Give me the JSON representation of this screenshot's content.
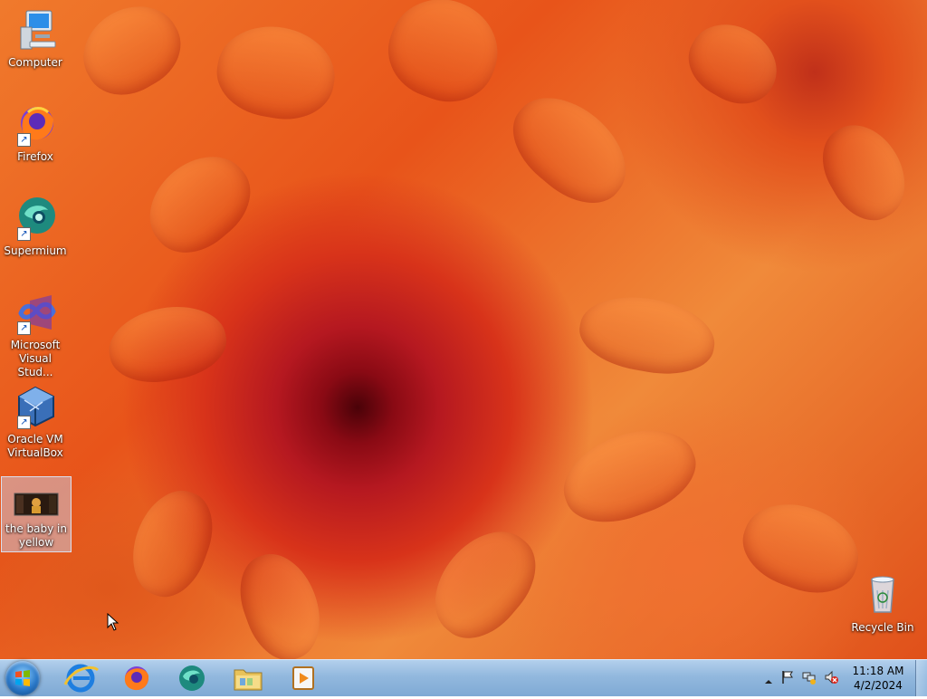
{
  "desktop": {
    "icons": [
      {
        "label": "Computer",
        "icon": "computer-icon"
      },
      {
        "label": "Firefox",
        "icon": "firefox-icon"
      },
      {
        "label": "Supermium",
        "icon": "supermium-icon"
      },
      {
        "label": "Microsoft Visual Stud...",
        "icon": "visual-studio-icon"
      },
      {
        "label": "Oracle VM VirtualBox",
        "icon": "virtualbox-icon"
      },
      {
        "label": "the baby in yellow",
        "icon": "video-file-icon"
      },
      {
        "label": "Recycle Bin",
        "icon": "recycle-bin-icon"
      }
    ]
  },
  "taskbar": {
    "start_icon": "windows-start-icon",
    "pinned": [
      {
        "name": "Internet Explorer",
        "icon": "internet-explorer-icon"
      },
      {
        "name": "Firefox",
        "icon": "firefox-icon"
      },
      {
        "name": "Supermium",
        "icon": "supermium-icon"
      },
      {
        "name": "File Explorer",
        "icon": "folder-icon"
      },
      {
        "name": "Media Player",
        "icon": "media-player-icon"
      }
    ],
    "tray": {
      "icons": [
        "show-hidden-icons-icon",
        "action-center-flag-icon",
        "network-icon",
        "volume-muted-icon"
      ],
      "time": "11:18 AM",
      "date": "4/2/2024"
    }
  }
}
